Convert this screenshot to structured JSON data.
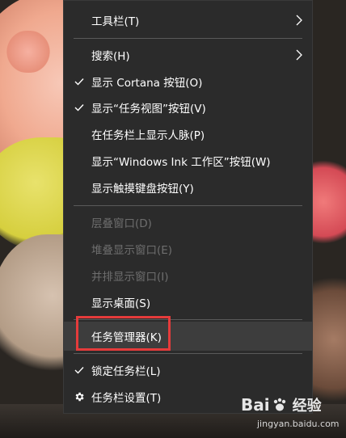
{
  "menu": {
    "items": [
      {
        "label": "工具栏(T)",
        "checked": false,
        "submenu": true,
        "disabled": false,
        "icon": null
      },
      {
        "label": "搜索(H)",
        "checked": false,
        "submenu": true,
        "disabled": false,
        "icon": null
      },
      {
        "label": "显示 Cortana 按钮(O)",
        "checked": true,
        "submenu": false,
        "disabled": false,
        "icon": null
      },
      {
        "label": "显示“任务视图”按钮(V)",
        "checked": true,
        "submenu": false,
        "disabled": false,
        "icon": null
      },
      {
        "label": "在任务栏上显示人脉(P)",
        "checked": false,
        "submenu": false,
        "disabled": false,
        "icon": null
      },
      {
        "label": "显示“Windows Ink 工作区”按钮(W)",
        "checked": false,
        "submenu": false,
        "disabled": false,
        "icon": null
      },
      {
        "label": "显示触摸键盘按钮(Y)",
        "checked": false,
        "submenu": false,
        "disabled": false,
        "icon": null
      },
      {
        "label": "层叠窗口(D)",
        "checked": false,
        "submenu": false,
        "disabled": true,
        "icon": null
      },
      {
        "label": "堆叠显示窗口(E)",
        "checked": false,
        "submenu": false,
        "disabled": true,
        "icon": null
      },
      {
        "label": "并排显示窗口(I)",
        "checked": false,
        "submenu": false,
        "disabled": true,
        "icon": null
      },
      {
        "label": "显示桌面(S)",
        "checked": false,
        "submenu": false,
        "disabled": false,
        "icon": null
      },
      {
        "label": "任务管理器(K)",
        "checked": false,
        "submenu": false,
        "disabled": false,
        "icon": null,
        "highlighted": true
      },
      {
        "label": "锁定任务栏(L)",
        "checked": true,
        "submenu": false,
        "disabled": false,
        "icon": null
      },
      {
        "label": "任务栏设置(T)",
        "checked": false,
        "submenu": false,
        "disabled": false,
        "icon": "gear-icon"
      }
    ]
  },
  "colors": {
    "menu_bg": "#2b2b2b",
    "highlight_bg": "#3d3d3d",
    "disabled_text": "#6e6e6e",
    "annotation_box": "#e53b3b"
  },
  "watermark": {
    "logo_left": "Bai",
    "logo_right": "经验",
    "url": "jingyan.baidu.com"
  }
}
